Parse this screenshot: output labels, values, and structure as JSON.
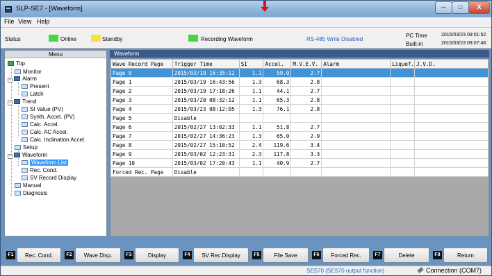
{
  "window": {
    "title": "SLP-SE7 - [Waveform]",
    "controls": {
      "minimize": "─",
      "maximize": "□",
      "close": "X"
    }
  },
  "menu": [
    "File",
    "View",
    "Help"
  ],
  "status": {
    "label": "Status",
    "online": "Online",
    "standby": "Standby",
    "recording": "Recording Waveform",
    "rs485": "RS-485 Write Disabled",
    "pc_time_label": "PC Time",
    "pc_time_value": "2015/03/23 09:01:52",
    "builtin_label": "Built-in",
    "builtin_value": "2015/03/23 09:07:46",
    "colors": {
      "online": "#4cd440",
      "standby": "#f6e04a",
      "recording": "#4cd440"
    }
  },
  "tree": {
    "header": "Menu",
    "nodes": [
      {
        "label": "Top"
      },
      {
        "label": "Monitor"
      },
      {
        "label": "Alarm"
      },
      {
        "label": "Present"
      },
      {
        "label": "Latch"
      },
      {
        "label": "Trend"
      },
      {
        "label": "SI Value (PV)"
      },
      {
        "label": "Synth. Accel. (PV)"
      },
      {
        "label": "Calc. Accel."
      },
      {
        "label": "Calc. AC Accel."
      },
      {
        "label": "Calc. Inclination Accel."
      },
      {
        "label": "Setup"
      },
      {
        "label": "Waveform"
      },
      {
        "label": "Waveform List"
      },
      {
        "label": "Rec. Cond."
      },
      {
        "label": "SV Record Display"
      },
      {
        "label": "Manual"
      },
      {
        "label": "Diagnosis"
      }
    ]
  },
  "main": {
    "header": "Waveform",
    "columns": [
      "Wave Record Page",
      "Trigger Time",
      "SI",
      "Accel.",
      "M.V.E.V.",
      "Alarm",
      "Liquef.",
      "J.V.D."
    ],
    "rows": [
      [
        "Page 0",
        "2015/03/19 16:35:12",
        "1.1",
        "59.0",
        "2.7",
        "",
        "",
        ""
      ],
      [
        "Page 1",
        "2015/03/19 16:43:56",
        "1.3",
        "68.3",
        "2.8",
        "",
        "",
        ""
      ],
      [
        "Page 2",
        "2015/03/19 17:18:26",
        "1.1",
        "44.1",
        "2.7",
        "",
        "",
        ""
      ],
      [
        "Page 3",
        "2015/03/20 08:32:12",
        "1.1",
        "65.3",
        "2.8",
        "",
        "",
        ""
      ],
      [
        "Page 4",
        "2015/03/23 08:12:05",
        "1.3",
        "76.1",
        "2.8",
        "",
        "",
        ""
      ],
      [
        "Page 5",
        "Disable",
        "",
        "",
        "",
        "",
        "",
        ""
      ],
      [
        "Page 6",
        "2015/02/27 13:02:33",
        "1.1",
        "51.8",
        "2.7",
        "",
        "",
        ""
      ],
      [
        "Page 7",
        "2015/02/27 14:36:23",
        "1.3",
        "65.0",
        "2.9",
        "",
        "",
        ""
      ],
      [
        "Page 8",
        "2015/02/27 15:10:52",
        "2.4",
        "119.6",
        "3.4",
        "",
        "",
        ""
      ],
      [
        "Page 9",
        "2015/03/02 12:23:31",
        "2.3",
        "117.8",
        "3.3",
        "",
        "",
        ""
      ],
      [
        "Page 10",
        "2015/03/02 17:20:43",
        "1.1",
        "40.9",
        "2.7",
        "",
        "",
        ""
      ],
      [
        "Forced Rec. Page",
        "Disable",
        "",
        "",
        "",
        "",
        "",
        ""
      ]
    ]
  },
  "function_keys": [
    {
      "key": "F1",
      "label": "Rec. Cond."
    },
    {
      "key": "F2",
      "label": "Wave Disp."
    },
    {
      "key": "F3",
      "label": "Display"
    },
    {
      "key": "F4",
      "label": "SV Rec.Display"
    },
    {
      "key": "F5",
      "label": "File Save"
    },
    {
      "key": "F6",
      "label": "Forced Rec."
    },
    {
      "key": "F7",
      "label": "Delete"
    },
    {
      "key": "F8",
      "label": "Return"
    }
  ],
  "bottom": {
    "ses": "SES70 (SES70 output function)",
    "connection": "Connection (COM7)"
  }
}
